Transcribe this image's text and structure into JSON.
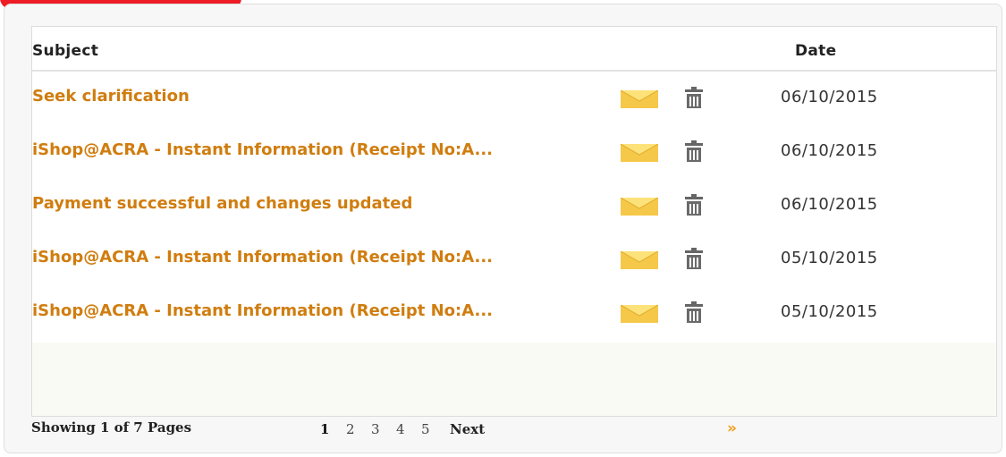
{
  "colors": {
    "accent": "#ee1c24",
    "subject_link": "#d07d0f",
    "last_arrow": "#f0a020"
  },
  "table": {
    "header_subject": "Subject",
    "header_date": "Date",
    "rows": [
      {
        "subject": "Seek clarification",
        "date": "06/10/2015",
        "mail_icon": "envelope-icon",
        "delete_icon": "trash-icon"
      },
      {
        "subject": "iShop@ACRA - Instant Information (Receipt No:A...",
        "date": "06/10/2015",
        "mail_icon": "envelope-icon",
        "delete_icon": "trash-icon"
      },
      {
        "subject": "Payment successful and changes updated",
        "date": "06/10/2015",
        "mail_icon": "envelope-icon",
        "delete_icon": "trash-icon"
      },
      {
        "subject": "iShop@ACRA - Instant Information (Receipt No:A...",
        "date": "05/10/2015",
        "mail_icon": "envelope-icon",
        "delete_icon": "trash-icon"
      },
      {
        "subject": "iShop@ACRA - Instant Information (Receipt No:A...",
        "date": "05/10/2015",
        "mail_icon": "envelope-icon",
        "delete_icon": "trash-icon"
      }
    ]
  },
  "pagination": {
    "showing": "Showing 1 of 7 Pages",
    "pages": [
      "1",
      "2",
      "3",
      "4",
      "5"
    ],
    "current_page": "1",
    "next_label": "Next",
    "last_label": "»"
  }
}
